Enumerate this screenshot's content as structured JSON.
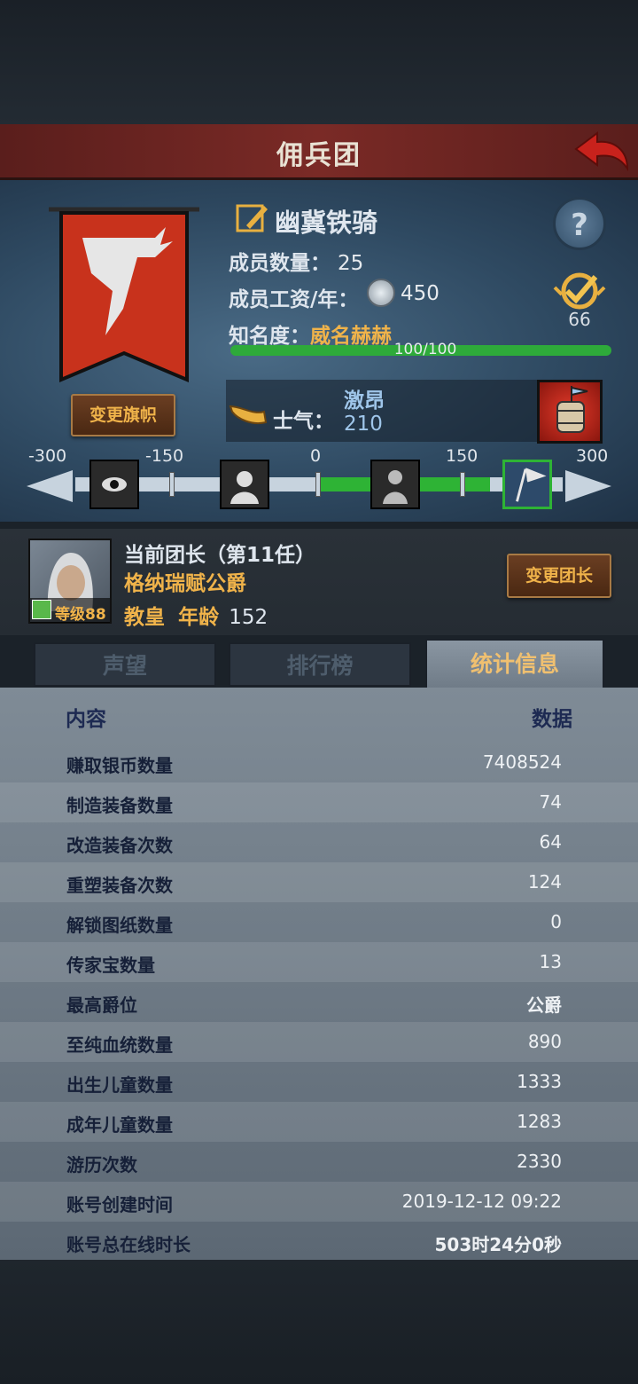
{
  "title": "佣兵团",
  "guild": {
    "name": "幽冀铁骑",
    "members_label": "成员数量：",
    "members_value": "25",
    "wage_label": "成员工资/年：",
    "wage_value": "450",
    "fame_label": "知名度：",
    "fame_value": "威名赫赫",
    "fame_progress": "100/100",
    "fame_fraction": 1.0,
    "rank_value": "66",
    "change_banner_button": "变更旗帜"
  },
  "morale": {
    "label": "士气：",
    "state": "激昂",
    "value": "210",
    "scale_ticks": [
      "-300",
      "-150",
      "0",
      "150",
      "300"
    ],
    "icons": [
      "fear-icon",
      "despair-icon",
      "calm-icon",
      "excited-icon"
    ]
  },
  "leader": {
    "title": "当前团长（第11任）",
    "name": "格纳瑞赋公爵",
    "level": "等级88",
    "religion": "教皇",
    "age_label": "年龄",
    "age_value": "152",
    "change_leader_button": "变更团长"
  },
  "tabs": [
    {
      "label": "声望",
      "active": false
    },
    {
      "label": "排行榜",
      "active": false
    },
    {
      "label": "统计信息",
      "active": true
    }
  ],
  "stats": {
    "header_content": "内容",
    "header_data": "数据",
    "rows": [
      {
        "label": "赚取银币数量",
        "value": "7408524"
      },
      {
        "label": "制造装备数量",
        "value": "74"
      },
      {
        "label": "改造装备次数",
        "value": "64"
      },
      {
        "label": "重塑装备次数",
        "value": "124"
      },
      {
        "label": "解锁图纸数量",
        "value": "0"
      },
      {
        "label": "传家宝数量",
        "value": "13"
      },
      {
        "label": "最高爵位",
        "value": "公爵"
      },
      {
        "label": "至纯血统数量",
        "value": "890"
      },
      {
        "label": "出生儿童数量",
        "value": "1333"
      },
      {
        "label": "成年儿童数量",
        "value": "1283"
      },
      {
        "label": "游历次数",
        "value": "2330"
      },
      {
        "label": "账号创建时间",
        "value": "2019-12-12 09:22"
      },
      {
        "label": "账号总在线时长",
        "value": "503时24分0秒"
      }
    ]
  },
  "colors": {
    "accent_gold": "#f0b34a",
    "morale_green": "#2eb335",
    "title_red": "#7a2a26"
  }
}
